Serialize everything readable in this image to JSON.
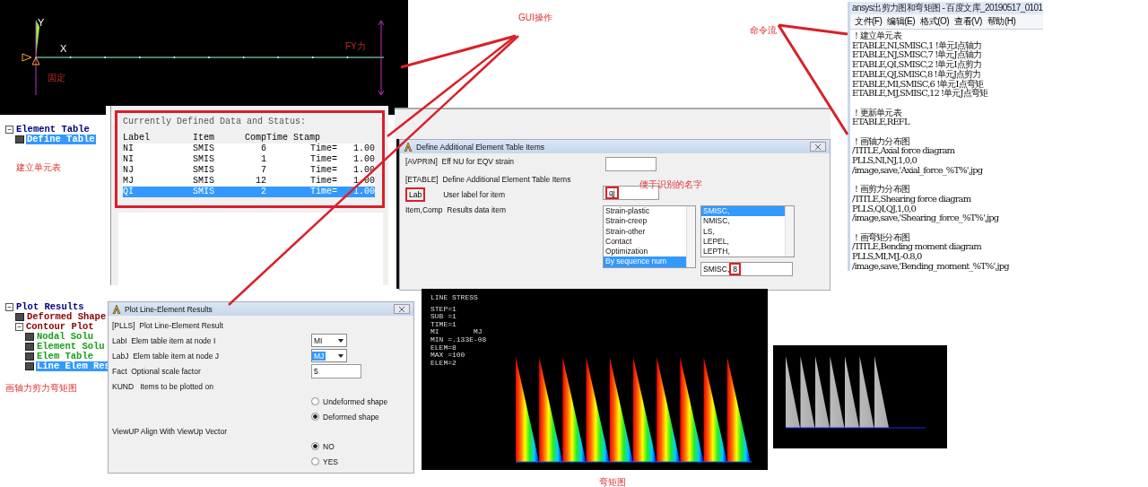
{
  "annotations": {
    "gui": "GUI操作",
    "commands": "命令流"
  },
  "beam_plot": {
    "y_label": "Y",
    "x_label": "X",
    "load_label": "FY力",
    "support_label": "固定"
  },
  "element_tree": {
    "items": [
      {
        "label": "Element Table",
        "expanded": true,
        "selected": false,
        "children": [
          {
            "label": "Define Table",
            "selected": true
          }
        ]
      }
    ],
    "note": "建立单元表"
  },
  "defined_data": {
    "title": "Currently Defined Data and Status:",
    "columns": [
      "Label",
      "Item",
      "Comp",
      "Time Stamp"
    ],
    "rows": [
      {
        "cells": [
          "NI",
          "SMIS",
          "6",
          "Time=   1.00"
        ],
        "selected": false
      },
      {
        "cells": [
          "NI",
          "SMIS",
          "1",
          "Time=   1.00"
        ],
        "selected": false
      },
      {
        "cells": [
          "NJ",
          "SMIS",
          "7",
          "Time=   1.00"
        ],
        "selected": false
      },
      {
        "cells": [
          "MJ",
          "SMIS",
          "12",
          "Time=   1.00"
        ],
        "selected": false
      },
      {
        "cells": [
          "QI",
          "SMIS",
          "2",
          "Time=   1.00"
        ],
        "selected": true
      }
    ]
  },
  "etable_dialog": {
    "title": "Define Additional Element Table Items",
    "avprin_label": "[AVPRIN]  Eff NU for EQV strain",
    "etable_label": "[ETABLE]  Define Additional Element Table Items",
    "lab_key": "Lab",
    "lab_text": "User label for item",
    "lab_value": "qj",
    "lab_note": "便于识别的名字",
    "item_label": "Item,Comp  Results data item",
    "categories": [
      {
        "label": "Strain-plastic",
        "selected": false
      },
      {
        "label": "Strain-creep",
        "selected": false
      },
      {
        "label": "Strain-other",
        "selected": false
      },
      {
        "label": "Contact",
        "selected": false
      },
      {
        "label": "Optimization",
        "selected": false
      },
      {
        "label": "By sequence num",
        "selected": true
      }
    ],
    "components": [
      {
        "label": "SMISC,",
        "selected": true
      },
      {
        "label": "NMISC,",
        "selected": false
      },
      {
        "label": "LS,",
        "selected": false
      },
      {
        "label": "LEPEL,",
        "selected": false
      },
      {
        "label": "LEPTH,",
        "selected": false
      }
    ],
    "comp_prefix": "SMISC,",
    "comp_value": "8"
  },
  "notepad": {
    "title": "ansys出剪力图和弯矩图 - 百度文库_20190517_0101",
    "menu": [
      "文件(F)",
      "编辑(E)",
      "格式(O)",
      "查看(V)",
      "帮助(H)"
    ],
    "groups": [
      {
        "lines": [
          "！建立单元表",
          "ETABLE,NI,SMISC,1 !单元I点轴力",
          "ETABLE,NJ,SMISC,7 !单元J点轴力",
          "ETABLE,QI,SMISC,2 !单元I点剪力",
          "ETABLE,QJ,SMISC,8 !单元J点剪力",
          "ETABLE,MI,SMISC,6 !单元I点弯矩",
          "ETABLE,MJ,SMISC,12 !单元J点弯矩"
        ]
      },
      {
        "lines": [
          "！更新单元表",
          "ETABLE,REFL"
        ]
      },
      {
        "lines": [
          "！画轴力分布图",
          "/TITLE,Axial force diagram",
          "PLLS,NI,NJ,1,0,0",
          "/image,save,'Axial_force_%T%',jpg"
        ]
      },
      {
        "lines": [
          "！画剪力分布图",
          "/TITLE,Shearing force diagram",
          "PLLS,QI,QJ,1,0,0",
          "/image,save,'Shearing_force_%T%',jpg"
        ]
      },
      {
        "lines": [
          "！画弯矩分布图",
          "/TITLE,Bending moment diagram",
          "PLLS,MI,MJ,-0.8,0",
          "/image,save,'Bending_moment_%T%',jpg"
        ]
      }
    ]
  },
  "plot_tree": {
    "items": [
      {
        "label": "Plot Results",
        "expanded": true,
        "selected": false,
        "children": [
          {
            "label": "Deformed Shape",
            "selected": false
          },
          {
            "label": "Contour Plot",
            "expanded": true,
            "selected": false,
            "children": [
              {
                "label": "Nodal Solu",
                "selected": false
              },
              {
                "label": "Element Solu",
                "selected": false
              },
              {
                "label": "Elem Table",
                "selected": false
              },
              {
                "label": "Line Elem Res",
                "selected": true
              }
            ]
          }
        ]
      }
    ],
    "note": "画轴力剪力弯矩图"
  },
  "plls_dialog": {
    "title": "Plot Line-Element Results",
    "rows": [
      {
        "kind": "heading",
        "label": "[PLLS]  Plot Line-Element Result"
      },
      {
        "kind": "select",
        "label": "LabI  Elem table item at node I",
        "value": "MI",
        "focused": false
      },
      {
        "kind": "select",
        "label": "LabJ  Elem table item at node J",
        "value": "MJ",
        "focused": true
      },
      {
        "kind": "input",
        "label": "Fact  Optional scale factor",
        "value": "5"
      },
      {
        "kind": "heading",
        "label": "KUND   Items to be plotted on"
      },
      {
        "kind": "radio",
        "label": "Undeformed shape",
        "selected": false
      },
      {
        "kind": "radio",
        "label": "Deformed shape",
        "selected": true
      },
      {
        "kind": "heading",
        "label": "ViewUP Align With ViewUp Vector"
      },
      {
        "kind": "radio",
        "label": "NO",
        "selected": true
      },
      {
        "kind": "radio",
        "label": "YES",
        "selected": false
      }
    ]
  },
  "stress_plot": {
    "lines": [
      "LINE STRESS",
      "STEP=1",
      "SUB =1",
      "TIME=1",
      "MI        MJ",
      "MIN =.133E-08",
      "ELEM=8",
      "MAX =100",
      "ELEM=2"
    ],
    "caption": "弯矩图"
  }
}
